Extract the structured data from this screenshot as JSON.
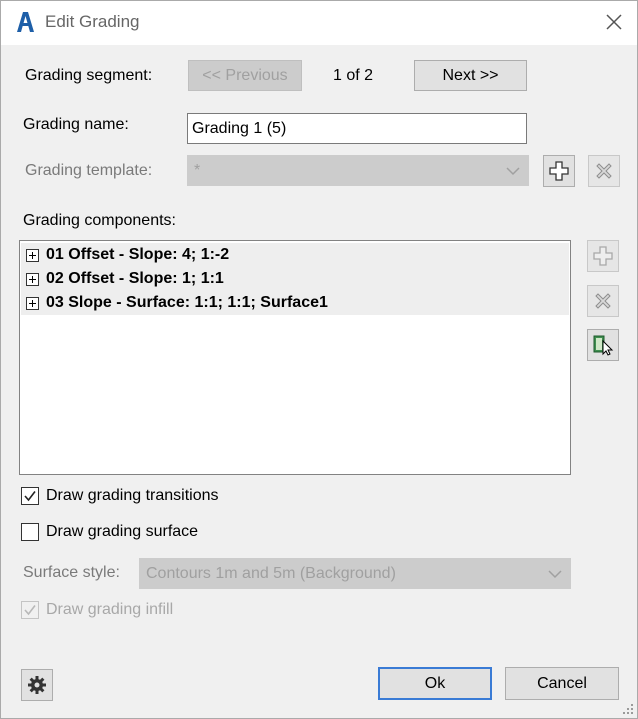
{
  "window": {
    "title": "Edit Grading",
    "app_icon": "autocad-icon",
    "close_icon": "close-icon"
  },
  "segment": {
    "label": "Grading segment:",
    "previous_label": "<< Previous",
    "position_text": "1 of 2",
    "next_label": "Next >>"
  },
  "name": {
    "label": "Grading name:",
    "value": "Grading 1 (5)"
  },
  "template": {
    "label": "Grading template:",
    "value": "*",
    "add_icon": "plus-icon",
    "delete_icon": "delete-x-icon"
  },
  "components": {
    "label": "Grading components:",
    "items": [
      {
        "label": "01 Offset - Slope: 4; 1:-2"
      },
      {
        "label": "02 Offset - Slope: 1; 1:1"
      },
      {
        "label": "03 Slope - Surface: 1:1; 1:1; Surface1"
      }
    ],
    "add_icon": "plus-icon",
    "delete_icon": "delete-x-icon",
    "select_icon": "pick-select-icon"
  },
  "options": {
    "transitions": {
      "label": "Draw grading transitions",
      "checked": true
    },
    "surface": {
      "label": "Draw grading surface",
      "checked": false
    },
    "surface_style": {
      "label": "Surface style:",
      "value": "Contours 1m and 5m (Background)"
    },
    "infill": {
      "label": "Draw grading infill",
      "checked": true
    }
  },
  "footer": {
    "settings_icon": "gear-icon",
    "ok_label": "Ok",
    "cancel_label": "Cancel"
  },
  "colors": {
    "dialog_bg": "#f0f0f0",
    "disabled_bg": "#cccccc",
    "accent": "#3a7bd5",
    "select_icon_green": "#1e7d3a"
  }
}
